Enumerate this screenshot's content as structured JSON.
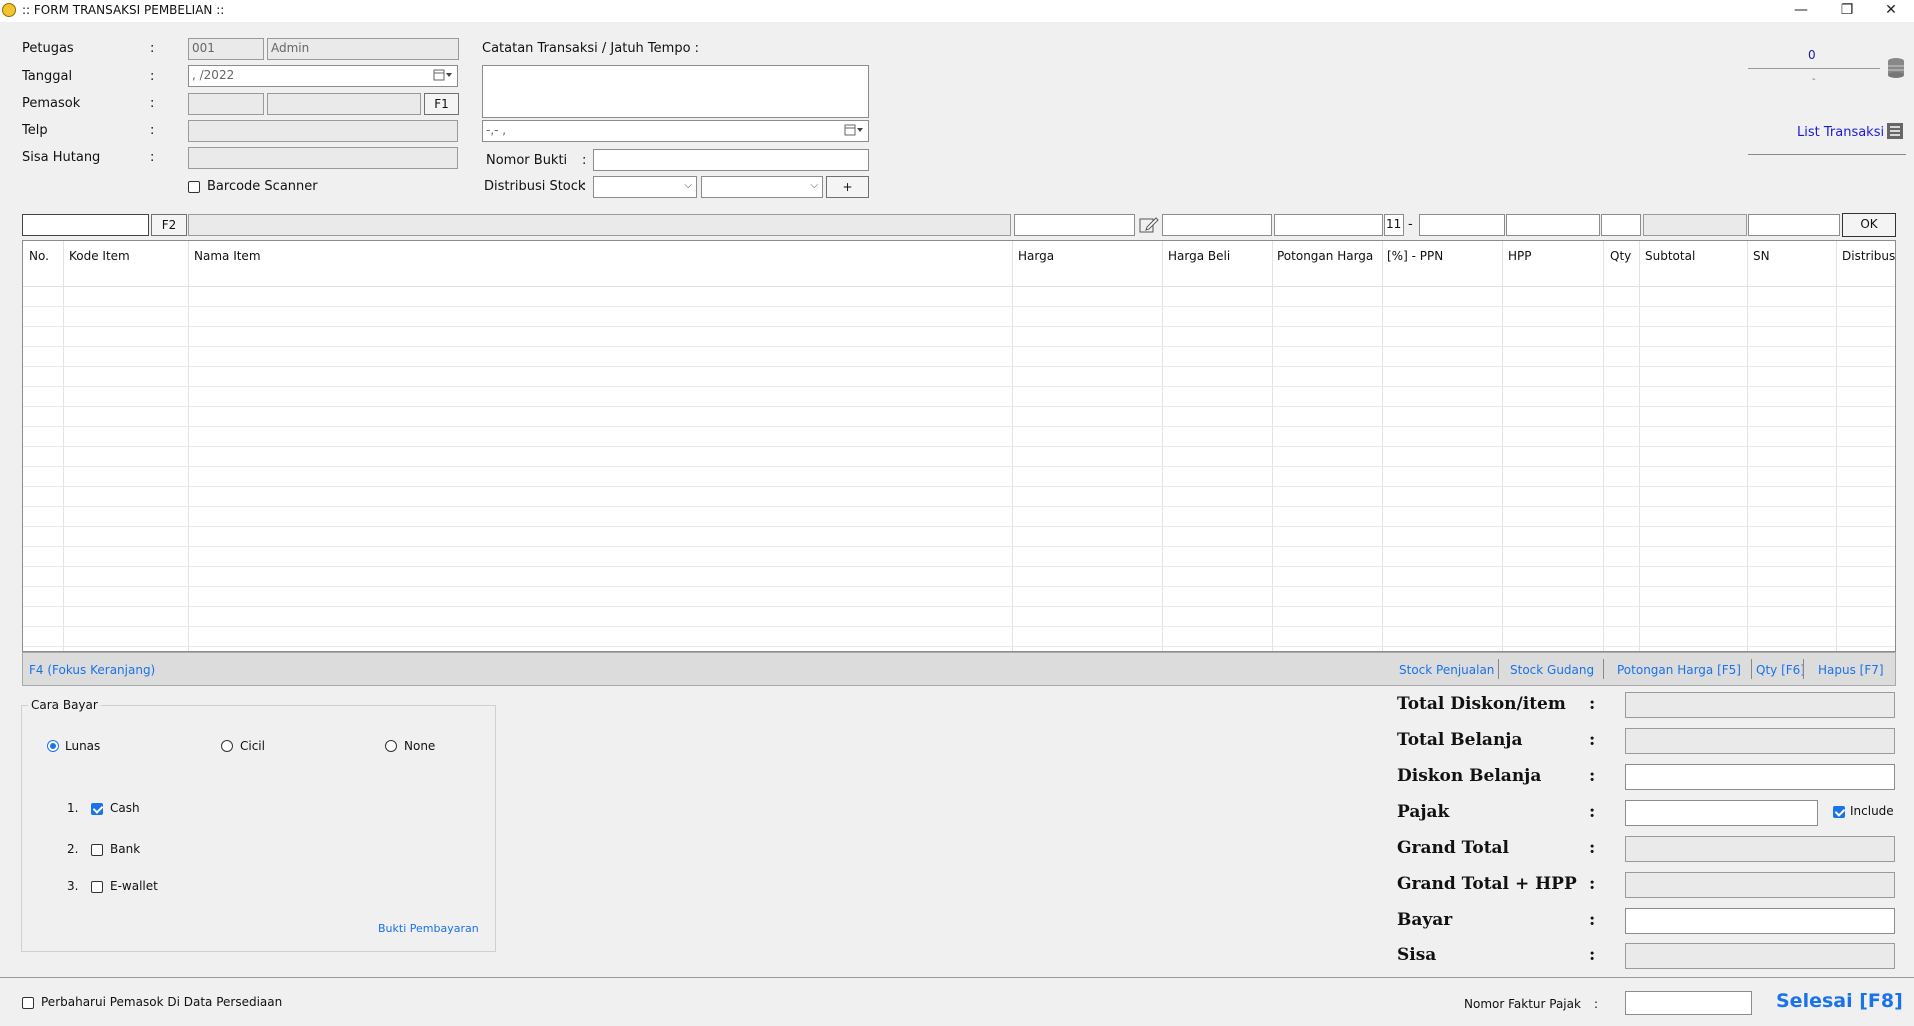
{
  "window": {
    "title": ":: FORM TRANSAKSI PEMBELIAN ::",
    "minimize": "—",
    "restore": "❐",
    "close": "✕"
  },
  "form": {
    "petugas_label": "Petugas",
    "petugas_code": "001",
    "petugas_name": "Admin",
    "tanggal_label": "Tanggal",
    "tanggal_value": "  ,  /2022",
    "pemasok_label": "Pemasok",
    "pemasok_btn": "F1",
    "telp_label": "Telp",
    "sisa_hutang_label": "Sisa Hutang",
    "barcode_label": "Barcode Scanner",
    "colon": ":",
    "catatan_label": "Catatan Transaksi / Jatuh Tempo :",
    "jatuh_tempo_value": " -,- ,",
    "nomor_bukti_label": "Nomor Bukti",
    "distribusi_label": "Distribusi Stock",
    "distribusi_add": "+"
  },
  "summary_top": {
    "amount": "0",
    "sub": "-",
    "list_transaksi": "List Transaksi"
  },
  "entry": {
    "f2": "F2",
    "ppn_value": "11",
    "dash": "-",
    "ok": "OK"
  },
  "columns": [
    "No.",
    "Kode Item",
    "Nama Item",
    "Harga",
    "Harga Beli",
    "Potongan Harga",
    "[%] - PPN",
    "HPP",
    "Qty",
    "Subtotal",
    "SN",
    "Distribus"
  ],
  "grid_footer": {
    "focus": "F4 (Fokus Keranjang)",
    "links": [
      "Stock Penjualan",
      "Stock Gudang",
      "Potongan Harga [F5]",
      "Qty [F6]",
      "Hapus [F7]"
    ]
  },
  "payment": {
    "group_label": "Cara Bayar",
    "options": [
      "Lunas",
      "Cicil",
      "None"
    ],
    "selected": "Lunas",
    "methods": [
      {
        "num": "1.",
        "label": "Cash",
        "checked": true
      },
      {
        "num": "2.",
        "label": "Bank",
        "checked": false
      },
      {
        "num": "3.",
        "label": "E-wallet",
        "checked": false
      }
    ],
    "bukti": "Bukti Pembayaran"
  },
  "totals": {
    "rows": [
      "Total Diskon/item",
      "Total Belanja",
      "Diskon Belanja",
      "Pajak",
      "Grand Total",
      "Grand Total + HPP",
      "Bayar",
      "Sisa"
    ],
    "include_label": "Include"
  },
  "footer": {
    "update_label": "Perbaharui Pemasok Di Data Persediaan",
    "faktur_label": "Nomor Faktur Pajak",
    "selesai": "Selesai [F8]"
  },
  "colors": {
    "accent": "#1a73e8",
    "link": "#1a73e8"
  }
}
